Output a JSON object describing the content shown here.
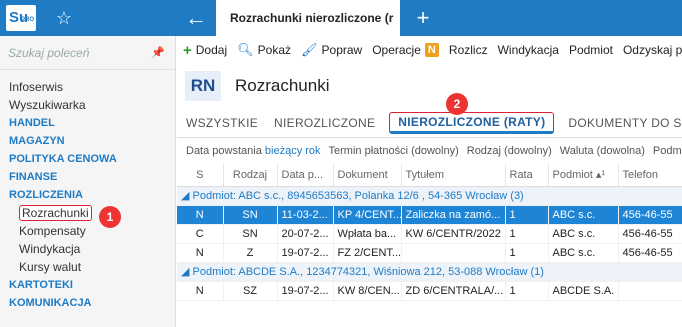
{
  "app": {
    "logo_text": "Su",
    "logo_sup": "PRO",
    "tab_title": "Rozrachunki nierozliczone (r"
  },
  "sidebar": {
    "search_placeholder": "Szukaj poleceń",
    "items": [
      {
        "label": "Infoserwis",
        "type": "item"
      },
      {
        "label": "Wyszukiwarka",
        "type": "item"
      },
      {
        "label": "HANDEL",
        "type": "section"
      },
      {
        "label": "MAGAZYN",
        "type": "section"
      },
      {
        "label": "POLITYKA CENOWA",
        "type": "section"
      },
      {
        "label": "FINANSE",
        "type": "section"
      },
      {
        "label": "ROZLICZENIA",
        "type": "section"
      },
      {
        "label": "Rozrachunki",
        "type": "sub-selected"
      },
      {
        "label": "Kompensaty",
        "type": "sub"
      },
      {
        "label": "Windykacja",
        "type": "sub"
      },
      {
        "label": "Kursy walut",
        "type": "sub"
      },
      {
        "label": "KARTOTEKI",
        "type": "section"
      },
      {
        "label": "KOMUNIKACJA",
        "type": "section"
      }
    ]
  },
  "toolbar": {
    "dodaj": "Dodaj",
    "pokaz": "Pokaż",
    "popraw": "Popraw",
    "operacje": "Operacje",
    "n_badge": "N",
    "rozlicz": "Rozlicz",
    "windykacja": "Windykacja",
    "podmiot": "Podmiot",
    "odzyskaj": "Odzyskaj pien"
  },
  "header": {
    "badge": "RN",
    "title": "Rozrachunki"
  },
  "tabs": [
    "WSZYSTKIE",
    "NIEROZLICZONE",
    "NIEROZLICZONE (RATY)",
    "DOKUMENTY DO SKOR"
  ],
  "filters": {
    "data_label": "Data powstania",
    "data_value": "bieżący rok",
    "termin": "Termin płatności (dowolny)",
    "rodzaj": "Rodzaj (dowolny)",
    "waluta": "Waluta (dowolna)",
    "podm": "Podm"
  },
  "table": {
    "headers": [
      "S",
      "Rodzaj",
      "Data p...",
      "Dokument",
      "Tytułem",
      "Rata",
      "Podmiot ▴¹",
      "Telefon"
    ],
    "group1": "◢ Podmiot: ABC s.c., 8945653563, Polanka  12/6 , 54-365 Wrocław (3)",
    "group2": "◢ Podmiot: ABCDE S.A., 1234774321, Wiśniowa 212, 53-088 Wrocław (1)",
    "rows": [
      [
        "N",
        "SN",
        "11-03-2...",
        "KP 4/CENT...",
        "Zaliczka na zamó...",
        "1",
        "ABC s.c.",
        "456-46-55"
      ],
      [
        "C",
        "SN",
        "20-07-2...",
        "Wpłata ba...",
        "KW 6/CENTR/2022",
        "1",
        "ABC s.c.",
        "456-46-55"
      ],
      [
        "N",
        "Z",
        "19-07-2...",
        "FZ 2/CENT...",
        "",
        "1",
        "ABC s.c.",
        "456-46-55"
      ],
      [
        "N",
        "SZ",
        "19-07-2...",
        "KW 8/CEN...",
        "ZD 6/CENTRALA/...",
        "1",
        "ABCDE S.A.",
        ""
      ]
    ]
  },
  "callouts": {
    "one": "1",
    "two": "2"
  },
  "colors": {
    "accent": "#1f7bc4",
    "selected_row": "#1d84d6",
    "callout": "#e33333"
  }
}
